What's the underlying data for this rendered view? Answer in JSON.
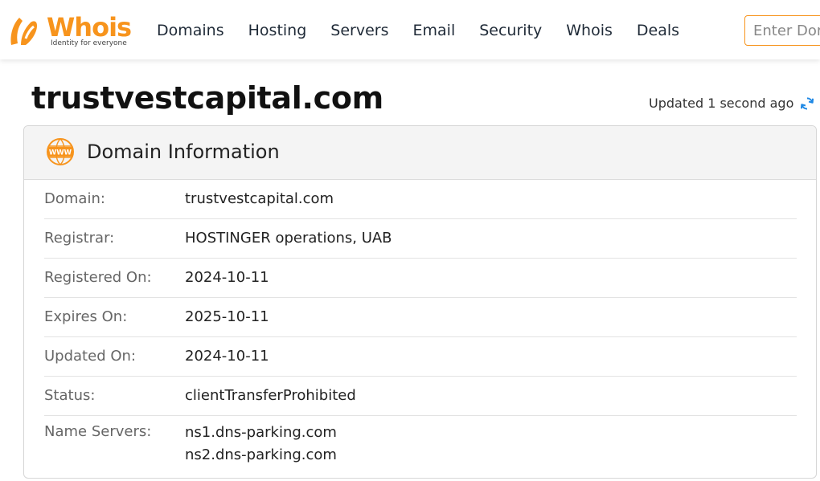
{
  "header": {
    "logo_text": "Whois",
    "logo_tagline": "Identity for everyone",
    "nav": [
      "Domains",
      "Hosting",
      "Servers",
      "Email",
      "Security",
      "Whois",
      "Deals"
    ],
    "search_placeholder": "Enter Domain"
  },
  "page": {
    "title": "trustvestcapital.com",
    "updated": "Updated 1 second ago"
  },
  "card": {
    "title": "Domain Information",
    "rows": [
      {
        "label": "Domain:",
        "value": "trustvestcapital.com"
      },
      {
        "label": "Registrar:",
        "value": "HOSTINGER operations, UAB"
      },
      {
        "label": "Registered On:",
        "value": "2024-10-11"
      },
      {
        "label": "Expires On:",
        "value": "2025-10-11"
      },
      {
        "label": "Updated On:",
        "value": "2024-10-11"
      },
      {
        "label": "Status:",
        "value": "clientTransferProhibited"
      }
    ],
    "name_servers": {
      "label": "Name Servers:",
      "values": [
        "ns1.dns-parking.com",
        "ns2.dns-parking.com"
      ]
    }
  },
  "colors": {
    "brand": "#f7941d",
    "refresh_icon": "#1e88e5"
  }
}
